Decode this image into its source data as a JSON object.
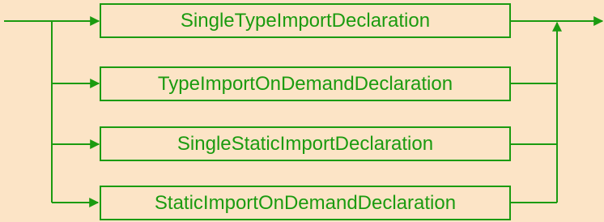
{
  "diagram": {
    "alternatives": [
      {
        "label": "SingleTypeImportDeclaration"
      },
      {
        "label": "TypeImportOnDemandDeclaration"
      },
      {
        "label": "SingleStaticImportDeclaration"
      },
      {
        "label": "StaticImportOnDemandDeclaration"
      }
    ],
    "colors": {
      "background": "#fce4c6",
      "line": "#1b9b10"
    }
  }
}
